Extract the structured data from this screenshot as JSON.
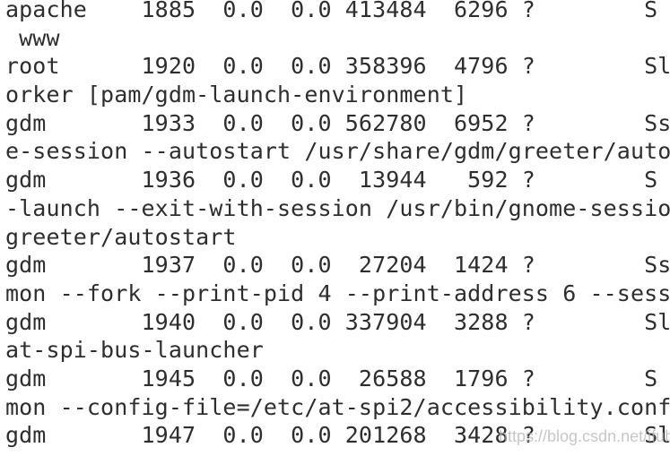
{
  "terminal": {
    "lines": [
      "apache    1885  0.0  0.0 413484  6296 ?        S",
      " www",
      "root      1920  0.0  0.0 358396  4796 ?        Sl",
      "orker [pam/gdm-launch-environment]",
      "gdm       1933  0.0  0.0 562780  6952 ?        Ss",
      "e-session --autostart /usr/share/gdm/greeter/auto",
      "gdm       1936  0.0  0.0  13944   592 ?        S",
      "-launch --exit-with-session /usr/bin/gnome-sessio",
      "greeter/autostart",
      "gdm       1937  0.0  0.0  27204  1424 ?        Ss",
      "mon --fork --print-pid 4 --print-address 6 --sess",
      "gdm       1940  0.0  0.0 337904  3288 ?        Sl",
      "at-spi-bus-launcher",
      "gdm       1945  0.0  0.0  26588  1796 ?        S",
      "mon --config-file=/etc/at-spi2/accessibility.conf",
      "gdm       1947  0.0  0.0 201268  3428 ?        Sl"
    ]
  },
  "watermark": "https://blog.csdn.net/ifubing"
}
